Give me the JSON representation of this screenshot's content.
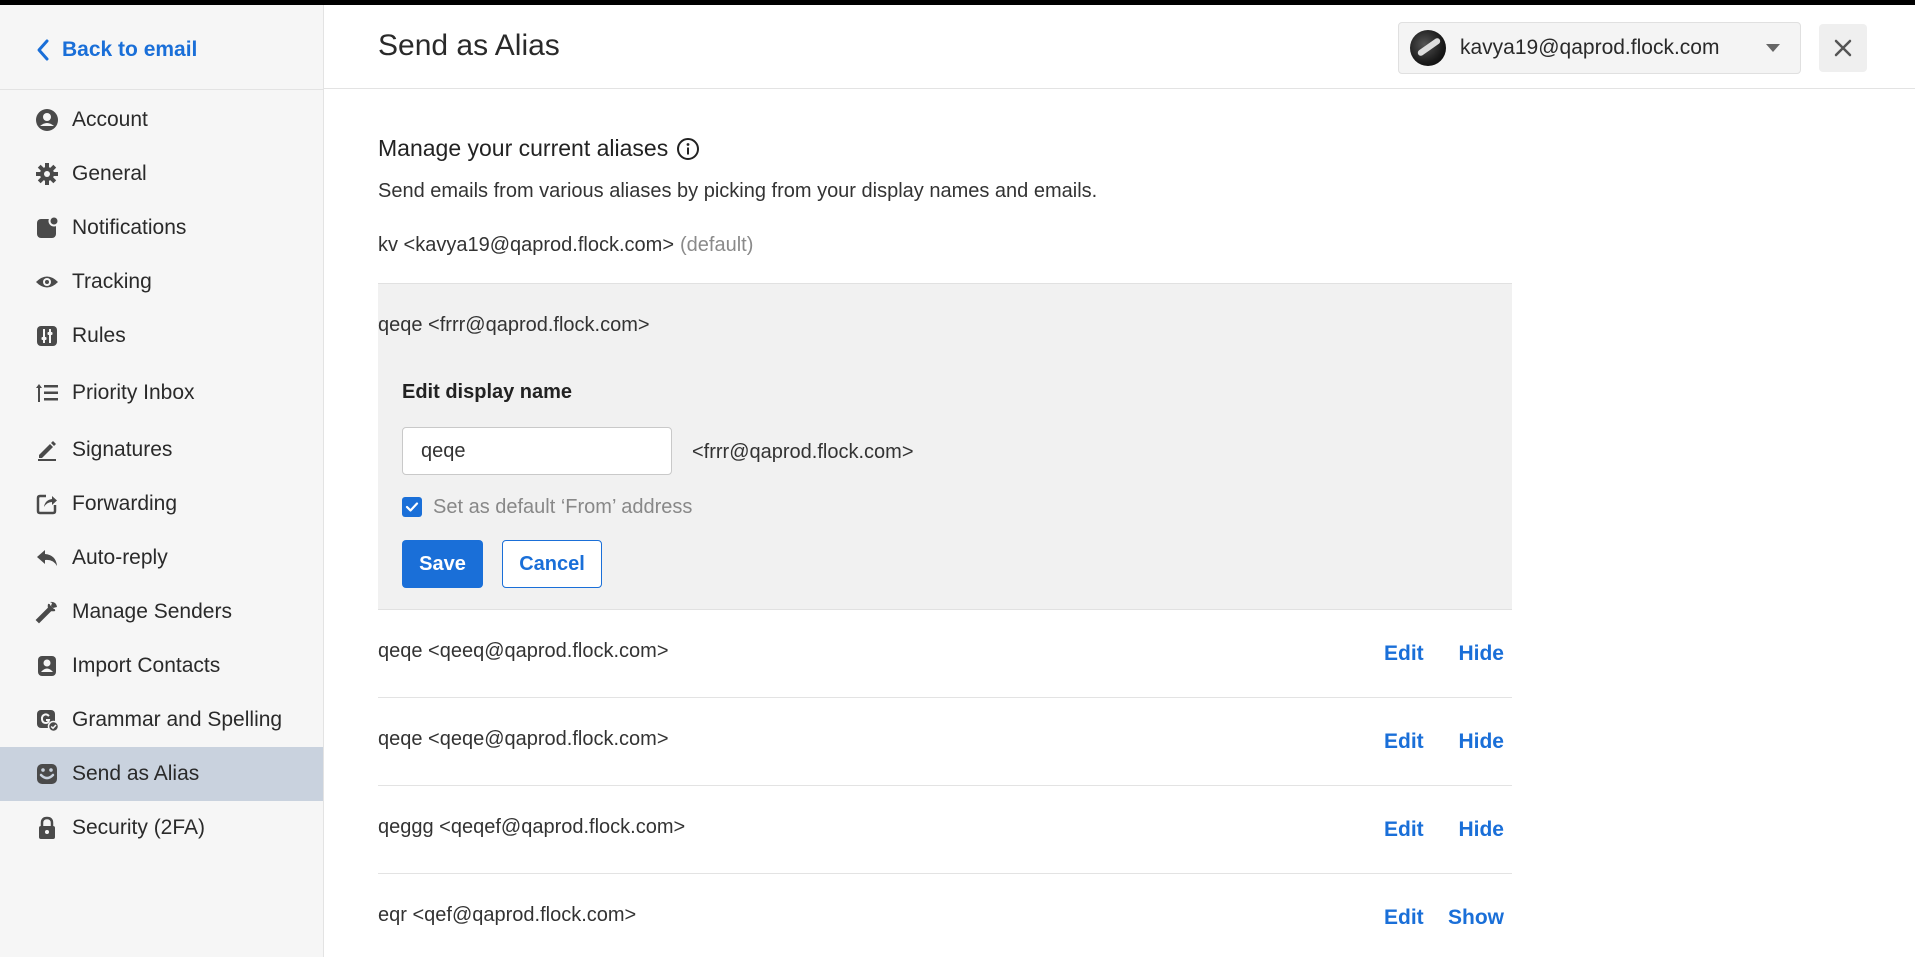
{
  "sidebar": {
    "back_label": "Back to email",
    "items": [
      {
        "label": "Account",
        "icon": "user-icon"
      },
      {
        "label": "General",
        "icon": "gear-icon"
      },
      {
        "label": "Notifications",
        "icon": "notification-icon"
      },
      {
        "label": "Tracking",
        "icon": "eye-icon"
      },
      {
        "label": "Rules",
        "icon": "sliders-icon"
      },
      {
        "label": "Priority Inbox",
        "icon": "priority-list-icon"
      },
      {
        "label": "Signatures",
        "icon": "pen-icon"
      },
      {
        "label": "Forwarding",
        "icon": "forward-icon"
      },
      {
        "label": "Auto-reply",
        "icon": "reply-icon"
      },
      {
        "label": "Manage Senders",
        "icon": "wrench-icon"
      },
      {
        "label": "Import Contacts",
        "icon": "contacts-icon"
      },
      {
        "label": "Grammar and Spelling",
        "icon": "grammar-icon"
      },
      {
        "label": "Send as Alias",
        "icon": "alias-mask-icon",
        "active": true
      },
      {
        "label": "Security (2FA)",
        "icon": "lock-icon"
      }
    ]
  },
  "header": {
    "title": "Send as Alias",
    "account_email": "kavya19@qaprod.flock.com"
  },
  "main": {
    "section_title": "Manage your current aliases",
    "section_desc": "Send emails from various aliases by picking from your display names and emails.",
    "default_alias": "kv <kavya19@qaprod.flock.com>",
    "default_tag": "(default)",
    "edit_panel": {
      "alias_text": "qeqe <frrr@qaprod.flock.com>",
      "title": "Edit display name",
      "input_value": "qeqe",
      "email": "<frrr@qaprod.flock.com>",
      "checkbox_label": "Set as default ‘From’ address",
      "checkbox_checked": true,
      "save_label": "Save",
      "cancel_label": "Cancel"
    },
    "aliases": [
      {
        "text": "qeqe <qeeq@qaprod.flock.com>",
        "edit": "Edit",
        "toggle": "Hide"
      },
      {
        "text": "qeqe <qeqe@qaprod.flock.com>",
        "edit": "Edit",
        "toggle": "Hide"
      },
      {
        "text": "qeggg <qeqef@qaprod.flock.com>",
        "edit": "Edit",
        "toggle": "Hide"
      },
      {
        "text": "eqr <qef@qaprod.flock.com>",
        "edit": "Edit",
        "toggle": "Show"
      }
    ]
  },
  "colors": {
    "accent": "#1a6fd8",
    "sidebar_bg": "#f6f6f6",
    "active_bg": "#c9d2de",
    "panel_bg": "#f1f1f1"
  }
}
